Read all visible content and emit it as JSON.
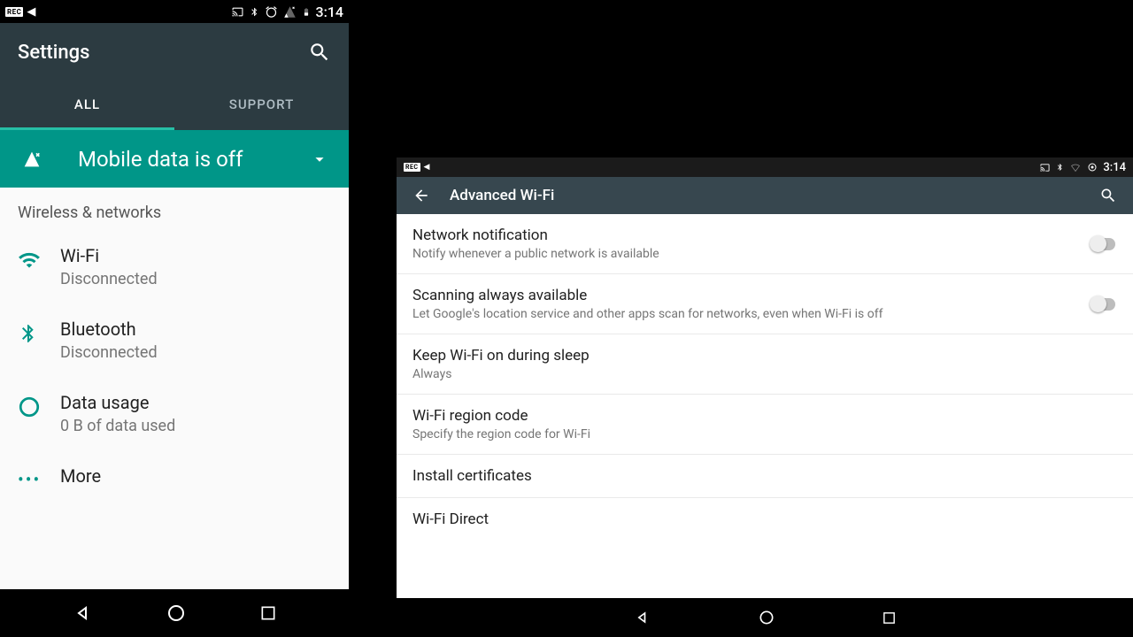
{
  "left": {
    "statusbar": {
      "rec_label": "REC",
      "time": "3:14"
    },
    "appbar": {
      "title": "Settings"
    },
    "tabs": {
      "all": "ALL",
      "support": "SUPPORT"
    },
    "banner": {
      "text": "Mobile data is off"
    },
    "section": "Wireless & networks",
    "rows": {
      "wifi": {
        "primary": "Wi-Fi",
        "secondary": "Disconnected"
      },
      "bluetooth": {
        "primary": "Bluetooth",
        "secondary": "Disconnected"
      },
      "data": {
        "primary": "Data usage",
        "secondary": "0 B of data used"
      },
      "more": {
        "primary": "More"
      }
    }
  },
  "right": {
    "statusbar": {
      "rec_label": "REC",
      "time": "3:14"
    },
    "appbar": {
      "title": "Advanced Wi-Fi"
    },
    "items": {
      "notif": {
        "primary": "Network notification",
        "secondary": "Notify whenever a public network is available"
      },
      "scan": {
        "primary": "Scanning always available",
        "secondary": "Let Google's location service and other apps scan for networks, even when Wi-Fi is off"
      },
      "sleep": {
        "primary": "Keep Wi-Fi on during sleep",
        "secondary": "Always"
      },
      "region": {
        "primary": "Wi-Fi region code",
        "secondary": "Specify the region code for Wi-Fi"
      },
      "certs": {
        "primary": "Install certificates"
      },
      "direct": {
        "primary": "Wi-Fi Direct"
      }
    }
  }
}
